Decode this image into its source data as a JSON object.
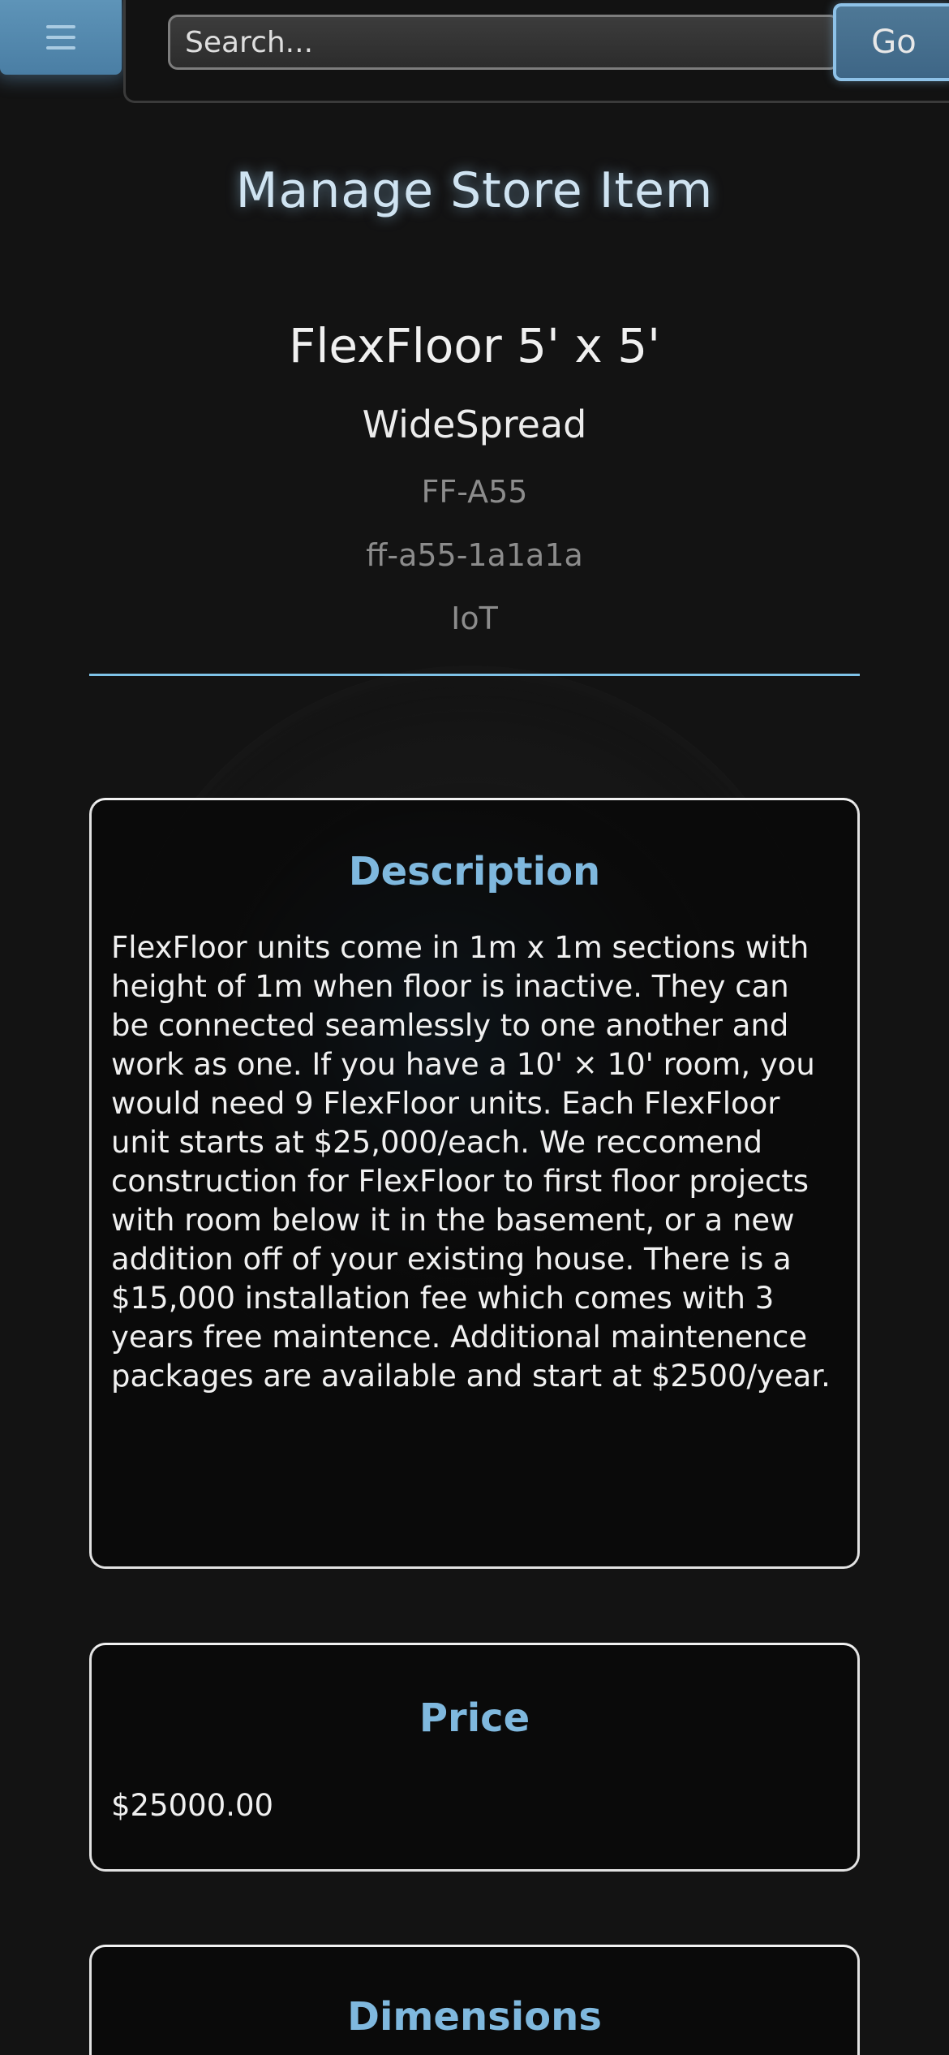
{
  "header": {
    "menu_icon": "hamburger-menu-icon",
    "search_placeholder": "Search...",
    "go_label": "Go"
  },
  "page_title": "Manage Store Item",
  "item": {
    "name": "FlexFloor 5' x 5'",
    "brand": "WideSpread",
    "sku": "FF-A55",
    "slug": "ff-a55-1a1a1a",
    "category": "IoT"
  },
  "description": {
    "title": "Description",
    "text": "FlexFloor units come in 1m x 1m sections with height of 1m when floor is inactive. They can be connected seamlessly to one another and work as one. If you have a 10' × 10' room, you would need 9 FlexFloor units. Each FlexFloor unit starts at $25,000/each. We reccomend construction for FlexFloor to first floor projects with room below it in the basement, or a new addition off of your existing house. There is a $15,000 installation fee which comes with 3 years free maintence. Additional maintenence packages are available and start at $2500/year."
  },
  "price": {
    "title": "Price",
    "value": "$25000.00"
  },
  "dimensions": {
    "title": "Dimensions"
  },
  "colors": {
    "background": "#131313",
    "accent": "#7fb8de",
    "menu_button": "#5a8fb3",
    "divider": "#7fc3e8"
  }
}
